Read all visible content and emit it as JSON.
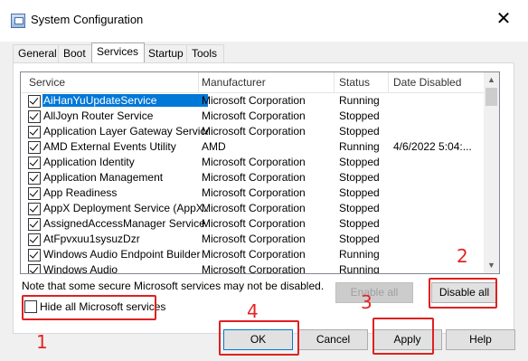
{
  "window": {
    "title": "System Configuration",
    "close_glyph": "✕"
  },
  "tabs": [
    {
      "label": "General"
    },
    {
      "label": "Boot"
    },
    {
      "label": "Services",
      "active": true
    },
    {
      "label": "Startup"
    },
    {
      "label": "Tools"
    }
  ],
  "list": {
    "columns": [
      "Service",
      "Manufacturer",
      "Status",
      "Date Disabled"
    ],
    "rows": [
      {
        "service": "AiHanYuUpdateService",
        "manufacturer": "Microsoft Corporation",
        "status": "Running",
        "date": "",
        "checked": true,
        "selected": true
      },
      {
        "service": "AllJoyn Router Service",
        "manufacturer": "Microsoft Corporation",
        "status": "Stopped",
        "date": "",
        "checked": true
      },
      {
        "service": "Application Layer Gateway Service",
        "manufacturer": "Microsoft Corporation",
        "status": "Stopped",
        "date": "",
        "checked": true
      },
      {
        "service": "AMD External Events Utility",
        "manufacturer": "AMD",
        "status": "Running",
        "date": "4/6/2022 5:04:...",
        "checked": true
      },
      {
        "service": "Application Identity",
        "manufacturer": "Microsoft Corporation",
        "status": "Stopped",
        "date": "",
        "checked": true
      },
      {
        "service": "Application Management",
        "manufacturer": "Microsoft Corporation",
        "status": "Stopped",
        "date": "",
        "checked": true
      },
      {
        "service": "App Readiness",
        "manufacturer": "Microsoft Corporation",
        "status": "Stopped",
        "date": "",
        "checked": true
      },
      {
        "service": "AppX Deployment Service (AppX...",
        "manufacturer": "Microsoft Corporation",
        "status": "Stopped",
        "date": "",
        "checked": true
      },
      {
        "service": "AssignedAccessManager Service",
        "manufacturer": "Microsoft Corporation",
        "status": "Stopped",
        "date": "",
        "checked": true
      },
      {
        "service": "AtFpvxuu1sysuzDzr",
        "manufacturer": "Microsoft Corporation",
        "status": "Stopped",
        "date": "",
        "checked": true
      },
      {
        "service": "Windows Audio Endpoint Builder",
        "manufacturer": "Microsoft Corporation",
        "status": "Running",
        "date": "",
        "checked": true
      },
      {
        "service": "Windows Audio",
        "manufacturer": "Microsoft Corporation",
        "status": "Running",
        "date": "",
        "checked": true
      }
    ]
  },
  "note": "Note that some secure Microsoft services may not be disabled.",
  "buttons": {
    "enable_all": "Enable all",
    "disable_all": "Disable all",
    "ok": "OK",
    "cancel": "Cancel",
    "apply": "Apply",
    "help": "Help"
  },
  "hide_ms": {
    "label": "Hide all Microsoft services",
    "checked": false
  },
  "annotations": {
    "n1": "1",
    "n2": "2",
    "n3": "3",
    "n4": "4",
    "color": "#e02020"
  }
}
